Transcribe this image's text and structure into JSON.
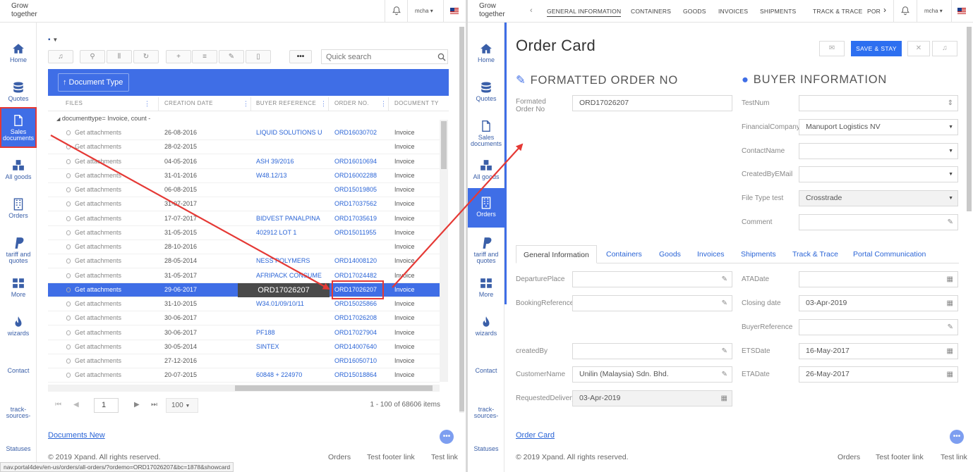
{
  "logo_alt": "Grow together",
  "user": "mcha",
  "sidebar": [
    {
      "label": "Home",
      "icon": "home-icon"
    },
    {
      "label": "Quotes",
      "icon": "database-icon"
    },
    {
      "label": "Sales documents",
      "icon": "document-icon"
    },
    {
      "label": "All goods",
      "icon": "cubes-icon"
    },
    {
      "label": "Orders",
      "icon": "building-icon"
    },
    {
      "label": "tariff and quotes",
      "icon": "paypal-icon"
    },
    {
      "label": "More",
      "icon": "grid-icon"
    },
    {
      "label": "wizards",
      "icon": "flame-icon"
    },
    {
      "label": "Contact",
      "icon": ""
    },
    {
      "label": "track-sources-",
      "icon": ""
    },
    {
      "label": "Statuses",
      "icon": ""
    }
  ],
  "left": {
    "search_placeholder": "Quick search",
    "group_chip": "↑ Document Type",
    "columns": [
      "FILES",
      "CREATION DATE",
      "BUYER REFERENCE",
      "ORDER NO.",
      "DOCUMENT TY"
    ],
    "group_label": "documenttype= Invoice, count -",
    "rows": [
      {
        "file": "Get attachments",
        "date": "26-08-2016",
        "buyer": "LIQUID SOLUTIONS U",
        "order": "ORD16030702",
        "type": "Invoice"
      },
      {
        "file": "Get attachments",
        "date": "28-02-2015",
        "buyer": "",
        "order": "",
        "type": "Invoice"
      },
      {
        "file": "Get attachments",
        "date": "04-05-2016",
        "buyer": "ASH 39/2016",
        "order": "ORD16010694",
        "type": "Invoice"
      },
      {
        "file": "Get attachments",
        "date": "31-01-2016",
        "buyer": "W48.12/13",
        "order": "ORD16002288",
        "type": "Invoice"
      },
      {
        "file": "Get attachments",
        "date": "06-08-2015",
        "buyer": "",
        "order": "ORD15019805",
        "type": "Invoice"
      },
      {
        "file": "Get attachments",
        "date": "31-07-2017",
        "buyer": "",
        "order": "ORD17037562",
        "type": "Invoice"
      },
      {
        "file": "Get attachments",
        "date": "17-07-2017",
        "buyer": "BIDVEST PANALPINA",
        "order": "ORD17035619",
        "type": "Invoice"
      },
      {
        "file": "Get attachments",
        "date": "31-05-2015",
        "buyer": "402912 LOT 1",
        "order": "ORD15011955",
        "type": "Invoice"
      },
      {
        "file": "Get attachments",
        "date": "28-10-2016",
        "buyer": "",
        "order": "",
        "type": "Invoice"
      },
      {
        "file": "Get attachments",
        "date": "28-05-2014",
        "buyer": "NESS POLYMERS",
        "order": "ORD14008120",
        "type": "Invoice"
      },
      {
        "file": "Get attachments",
        "date": "31-05-2017",
        "buyer": "AFRIPACK CONSUME",
        "order": "ORD17024482",
        "type": "Invoice"
      },
      {
        "file": "Get attachments",
        "date": "29-06-2017",
        "buyer": "",
        "order": "ORD17026207",
        "type": "Invoice",
        "selected": true
      },
      {
        "file": "Get attachments",
        "date": "31-10-2015",
        "buyer": "W34.01/09/10/11",
        "order": "ORD15025866",
        "type": "Invoice"
      },
      {
        "file": "Get attachments",
        "date": "30-06-2017",
        "buyer": "",
        "order": "ORD17026208",
        "type": "Invoice"
      },
      {
        "file": "Get attachments",
        "date": "30-06-2017",
        "buyer": "PF188",
        "order": "ORD17027904",
        "type": "Invoice"
      },
      {
        "file": "Get attachments",
        "date": "30-05-2014",
        "buyer": "SINTEX",
        "order": "ORD14007640",
        "type": "Invoice"
      },
      {
        "file": "Get attachments",
        "date": "27-12-2016",
        "buyer": "",
        "order": "ORD16050710",
        "type": "Invoice"
      },
      {
        "file": "Get attachments",
        "date": "20-07-2015",
        "buyer": "60848 + 224970",
        "order": "ORD15018864",
        "type": "Invoice"
      }
    ],
    "tooltip": "ORD17026207",
    "pager": {
      "page": "1",
      "page_size": "100",
      "summary": "1 - 100 of 68606 items"
    },
    "footer_link": "Documents New",
    "copyright": "© 2019 Xpand. All rights reserved.",
    "footer_links": [
      "Orders",
      "Test footer link",
      "Test link"
    ],
    "status_url": "nav.portal4dev/en-us/orders/all-orders/?ordemo=ORD17026207&bc=1878&showcard"
  },
  "right": {
    "nav_tabs": [
      "GENERAL INFORMATION",
      "CONTAINERS",
      "GOODS",
      "INVOICES",
      "SHIPMENTS",
      "TRACK & TRACE",
      "POR"
    ],
    "title": "Order Card",
    "save_label": "SAVE & STAY",
    "section_left": "FORMATTED ORDER NO",
    "section_right": "BUYER INFORMATION",
    "formatted_label": "Formated Order No",
    "formatted_value": "ORD17026207",
    "buyer_fields": [
      {
        "label": "TestNum",
        "value": "",
        "icon": "spinner-icon"
      },
      {
        "label": "FinancialCompany",
        "value": "Manuport Logistics NV",
        "icon": "caret-down-icon"
      },
      {
        "label": "ContactName",
        "value": "",
        "icon": "caret-down-icon"
      },
      {
        "label": "CreatedByEMail",
        "value": "",
        "icon": "caret-down-icon"
      },
      {
        "label": "File Type test",
        "value": "Crosstrade",
        "icon": "caret-down-icon"
      },
      {
        "label": "Comment",
        "value": "",
        "icon": "pencil-icon"
      }
    ],
    "tabs": [
      "General Information",
      "Containers",
      "Goods",
      "Invoices",
      "Shipments",
      "Track & Trace",
      "Portal Communication"
    ],
    "gen_left": [
      {
        "label": "DeparturePlace",
        "value": ""
      },
      {
        "label": "BookingReference",
        "value": ""
      },
      {
        "label": "createdBy",
        "value": ""
      },
      {
        "label": "CustomerName",
        "value": "Unilin (Malaysia) Sdn. Bhd."
      },
      {
        "label": "RequestedDelivery",
        "value": "03-Apr-2019"
      }
    ],
    "gen_right": [
      {
        "label": "ATADate",
        "value": ""
      },
      {
        "label": "Closing date",
        "value": "03-Apr-2019"
      },
      {
        "label": "BuyerReference",
        "value": ""
      },
      {
        "label": "ETSDate",
        "value": "16-May-2017"
      },
      {
        "label": "ETADate",
        "value": "26-May-2017"
      }
    ],
    "footer_link": "Order Card",
    "copyright": "© 2019 Xpand. All rights reserved.",
    "footer_links": [
      "Orders",
      "Test footer link",
      "Test link"
    ]
  }
}
